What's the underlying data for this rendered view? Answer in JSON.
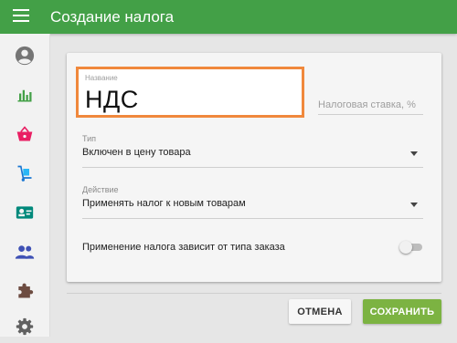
{
  "header": {
    "title": "Создание налога",
    "menu_icon": "menu-icon"
  },
  "sidebar": {
    "items": [
      {
        "id": "profile",
        "icon": "account-circle-icon",
        "color": "#757575"
      },
      {
        "id": "analytics",
        "icon": "bar-chart-icon",
        "color": "#43a047"
      },
      {
        "id": "sales",
        "icon": "shopping-basket-icon",
        "color": "#e91e63"
      },
      {
        "id": "inventory",
        "icon": "dolly-cart-icon",
        "color": "#03a9f4"
      },
      {
        "id": "contacts",
        "icon": "contact-card-icon",
        "color": "#00897b"
      },
      {
        "id": "users",
        "icon": "people-icon",
        "color": "#3f51b5"
      },
      {
        "id": "plugins",
        "icon": "puzzle-icon",
        "color": "#6d4c41"
      },
      {
        "id": "settings",
        "icon": "gear-icon",
        "color": "#616161"
      }
    ]
  },
  "form": {
    "name": {
      "label": "Название",
      "value": "НДС"
    },
    "rate": {
      "placeholder": "Налоговая ставка, %"
    },
    "type": {
      "label": "Тип",
      "value": "Включен в цену товара"
    },
    "action": {
      "label": "Действие",
      "value": "Применять налог к новым товарам"
    },
    "order_type_toggle": {
      "label": "Применение налога зависит от типа заказа",
      "checked": false
    }
  },
  "buttons": {
    "cancel": "ОТМЕНА",
    "save": "СОХРАНИТЬ"
  },
  "colors": {
    "header": "#43a047",
    "save_button": "#7cb342",
    "focus_outline": "#f0883c"
  }
}
